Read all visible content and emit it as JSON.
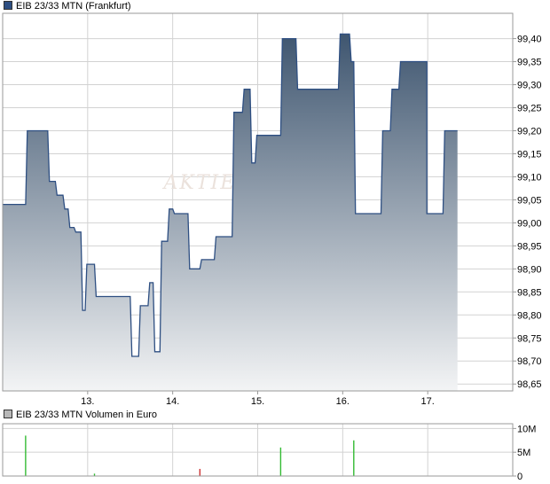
{
  "colors": {
    "line": "#2e4f82",
    "area_top": "#3f5670",
    "area_bottom": "#f3f4f5",
    "grid": "#d2d2d2",
    "frame": "#9a9a9a",
    "volume_green": "#33bb33",
    "volume_red": "#cc3333",
    "legend_price_swatch": "#2e4f82",
    "legend_volume_swatch": "#b8b8b8",
    "watermark": "#ebe2dc"
  },
  "chart_data": [
    {
      "type": "area",
      "title": "EIB 23/33 MTN (Frankfurt)",
      "series_name": "EIB 23/33 MTN (Frankfurt)",
      "xlabel": "",
      "ylabel": "",
      "xlim": [
        12.0,
        18.0
      ],
      "ylim": [
        98.635,
        99.455
      ],
      "x_ticks": [
        13,
        14,
        15,
        16,
        17
      ],
      "x_tick_labels": [
        "13.",
        "14.",
        "15.",
        "16.",
        "17."
      ],
      "y_ticks": [
        98.65,
        98.7,
        98.75,
        98.8,
        98.85,
        98.9,
        98.95,
        99.0,
        99.05,
        99.1,
        99.15,
        99.2,
        99.25,
        99.3,
        99.35,
        99.4
      ],
      "y_tick_labels": [
        "98,65",
        "98,70",
        "98,75",
        "98,80",
        "98,85",
        "98,90",
        "98,95",
        "99,00",
        "99,05",
        "99,10",
        "99,15",
        "99,20",
        "99,25",
        "99,30",
        "99,35",
        "99,40"
      ],
      "grid": true,
      "axis_position": "right",
      "watermark": "AKTIEN",
      "x": [
        12.0,
        12.27,
        12.29,
        12.53,
        12.55,
        12.62,
        12.64,
        12.71,
        12.73,
        12.77,
        12.79,
        12.84,
        12.86,
        12.92,
        12.94,
        12.97,
        12.99,
        13.08,
        13.1,
        13.5,
        13.52,
        13.6,
        13.62,
        13.71,
        13.73,
        13.77,
        13.79,
        13.85,
        13.87,
        13.94,
        13.96,
        14.0,
        14.02,
        14.18,
        14.2,
        14.32,
        14.34,
        14.49,
        14.51,
        14.7,
        14.72,
        14.82,
        14.84,
        14.91,
        14.93,
        14.97,
        14.99,
        15.27,
        15.29,
        15.45,
        15.47,
        15.95,
        15.97,
        16.08,
        16.1,
        16.13,
        16.15,
        16.45,
        16.47,
        16.56,
        16.58,
        16.66,
        16.68,
        16.87,
        16.89,
        16.99,
        16.99,
        17.18,
        17.2,
        17.35
      ],
      "y": [
        99.04,
        99.04,
        99.2,
        99.2,
        99.09,
        99.09,
        99.06,
        99.06,
        99.03,
        99.03,
        98.99,
        98.99,
        98.98,
        98.98,
        98.81,
        98.81,
        98.91,
        98.91,
        98.84,
        98.84,
        98.71,
        98.71,
        98.82,
        98.82,
        98.87,
        98.87,
        98.72,
        98.72,
        98.96,
        98.96,
        99.03,
        99.03,
        99.02,
        99.02,
        98.9,
        98.9,
        98.92,
        98.92,
        98.97,
        98.97,
        99.24,
        99.24,
        99.29,
        99.29,
        99.13,
        99.13,
        99.19,
        99.19,
        99.4,
        99.4,
        99.29,
        99.29,
        99.41,
        99.41,
        99.35,
        99.35,
        99.02,
        99.02,
        99.2,
        99.2,
        99.29,
        99.29,
        99.35,
        99.35,
        99.35,
        99.35,
        99.02,
        99.02,
        99.2,
        99.2
      ]
    },
    {
      "type": "bar",
      "title": "EIB 23/33 MTN Volumen in Euro",
      "series_name": "EIB 23/33 MTN Volumen in Euro",
      "xlabel": "",
      "ylabel": "",
      "xlim": [
        12.0,
        18.0
      ],
      "ylim": [
        0,
        11000000
      ],
      "y_ticks": [
        0,
        5000000,
        10000000
      ],
      "y_tick_labels": [
        "0",
        "5M",
        "10M"
      ],
      "axis_position": "right",
      "grid": true,
      "x": [
        12.27,
        13.08,
        14.32,
        15.27,
        16.13
      ],
      "values": [
        8500000,
        500000,
        1500000,
        6000000,
        7500000
      ],
      "direction": [
        "up",
        "up",
        "down",
        "up",
        "up"
      ]
    }
  ]
}
